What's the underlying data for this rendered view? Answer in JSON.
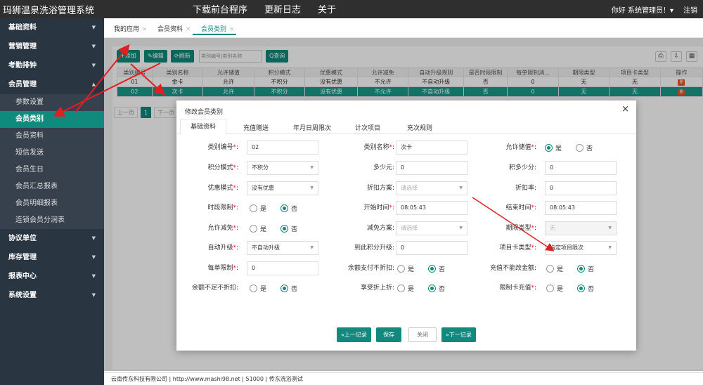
{
  "app": {
    "title": "玛狮温泉洗浴管理系统"
  },
  "topnav": [
    "下载前台程序",
    "更新日志",
    "关于"
  ],
  "user": {
    "greeting": "你好 系统管理员！▾",
    "logout": "注销"
  },
  "sidebar": {
    "groups_top": [
      "基础资料",
      "营销管理",
      "考勤排钟",
      "会员管理"
    ],
    "member_items": [
      "参数设置",
      "会员类别",
      "会员资料",
      "短信发送",
      "会员生日",
      "会员汇总报表",
      "会员明细报表",
      "连锁会员分润表"
    ],
    "groups_bottom": [
      "协议单位",
      "库存管理",
      "报表中心",
      "系统设置"
    ]
  },
  "tabs": [
    {
      "label": "我的应用",
      "active": false
    },
    {
      "label": "会员资料",
      "active": false
    },
    {
      "label": "会员类别",
      "active": true
    }
  ],
  "toolbar": {
    "add": "+添加",
    "edit": "✎编辑",
    "refresh": "⟳刷新",
    "search_placeholder": "类别编号|类别名称",
    "query": "Q查询"
  },
  "grid": {
    "columns": [
      "类别编号",
      "类别名称",
      "允许储值",
      "积分模式",
      "优惠模式",
      "允许减免",
      "自动升级规则",
      "是否时段限制",
      "每单限制消...",
      "期限类型",
      "项目卡类型",
      "操作"
    ],
    "rows": [
      [
        "01",
        "金卡",
        "允许",
        "不积分",
        "没有优惠",
        "不允许",
        "不自动升级",
        "否",
        "0",
        "无",
        "无"
      ],
      [
        "02",
        "次卡",
        "允许",
        "不积分",
        "没有优惠",
        "不允许",
        "不自动升级",
        "否",
        "0",
        "无",
        "无"
      ]
    ],
    "delete_label": "删"
  },
  "pager": {
    "prev": "上一页",
    "current": "1",
    "next": "下一页"
  },
  "footer": "云南传东科技有限公司 | http://www.mashi98.net | 51000 | 传东洗浴测试",
  "dialog": {
    "title": "修改会员类别",
    "close": "×",
    "tabs": [
      "基础资料",
      "充值赠送",
      "年月日周限次",
      "计次项目",
      "充次规则"
    ],
    "labels": {
      "code": "类别编号",
      "name": "类别名称",
      "allow_store": "允许储值",
      "points_mode": "积分模式",
      "yuan": "多少元",
      "points": "积多少分",
      "discount_mode": "优惠模式",
      "discount_plan": "折扣方案",
      "discount_rate": "折扣率",
      "time_limit": "时段限制",
      "start_time": "开始时间",
      "end_time": "结束时间",
      "allow_reduce": "允许减免",
      "reduce_plan": "减免方案",
      "period_type": "期限类型",
      "auto_upgrade": "自动升级",
      "upgrade_points": "到此积分升级",
      "card_type": "项目卡类型",
      "per_order_limit": "每单限制",
      "balance_no_discount": "余额支付不折扣",
      "recharge_no_change": "充值不能改金额",
      "insufficient_no_discount": "余额不足不折扣",
      "enjoy_discount": "享受折上折",
      "limit_recharge": "限制卡充值"
    },
    "values": {
      "code": "02",
      "name": "次卡",
      "points_mode": "不积分",
      "yuan": "0",
      "points": "0",
      "discount_mode": "没有优惠",
      "discount_plan_placeholder": "请选择",
      "discount_rate": "0",
      "start_time": "08:05:43",
      "end_time": "08:05:43",
      "reduce_plan_placeholder": "请选择",
      "period_type": "无",
      "auto_upgrade": "不自动升级",
      "upgrade_points": "0",
      "card_type": "指定项目限次",
      "per_order_limit": "0"
    },
    "yes": "是",
    "no": "否",
    "buttons": {
      "prev": "«上一记录",
      "save": "保存",
      "close": "关闭",
      "next": "»下一记录"
    }
  },
  "colors": {
    "accent": "#0f8a7d",
    "topbar": "#2f2f2f",
    "sidebar": "#2a3542",
    "danger": "#e05a2b",
    "annotation": "#e02020"
  }
}
